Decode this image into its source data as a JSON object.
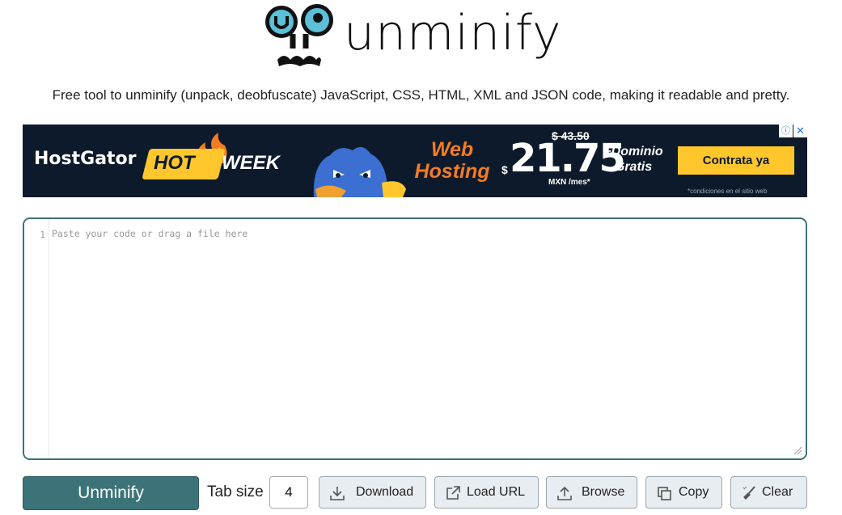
{
  "header": {
    "logo_text": "unminify"
  },
  "tagline": "Free tool to unminify (unpack, deobfuscate) JavaScript, CSS, HTML, XML and JSON code, making it readable and pretty.",
  "ad": {
    "brand": "HostGator",
    "hot": "HOT",
    "week": "WEEK",
    "service_line1": "Web",
    "service_line2": "Hosting",
    "old_price": "$ 43.50",
    "currency": "$",
    "price": "21.75",
    "unit": "MXN /mes*",
    "bonus_line1": "+Dominio",
    "bonus_line2": "Gratis",
    "cta": "Contrata ya",
    "fine_print": "*condiciones en el sitio web",
    "info_symbol": "ⓘ",
    "close_symbol": "✕"
  },
  "editor": {
    "line_number": "1",
    "placeholder": "Paste your code or drag a file here"
  },
  "toolbar": {
    "unminify_label": "Unminify",
    "tab_size_label": "Tab size",
    "tab_size_value": "4",
    "download_label": "Download",
    "load_url_label": "Load URL",
    "browse_label": "Browse",
    "copy_label": "Copy",
    "clear_label": "Clear"
  },
  "colors": {
    "accent": "#3b7378",
    "ad_background": "#0d1a2b",
    "ad_yellow": "#ffc72c",
    "ad_orange": "#f57b20",
    "logo_cyan": "#5bc0d8",
    "button_bg": "#e8edf2"
  },
  "icons": {
    "logo": "owl-face-logo",
    "download": "download-icon",
    "load_url": "external-link-icon",
    "browse": "upload-icon",
    "copy": "copy-icon",
    "clear": "broom-icon",
    "resize": "resize-handle-icon"
  }
}
